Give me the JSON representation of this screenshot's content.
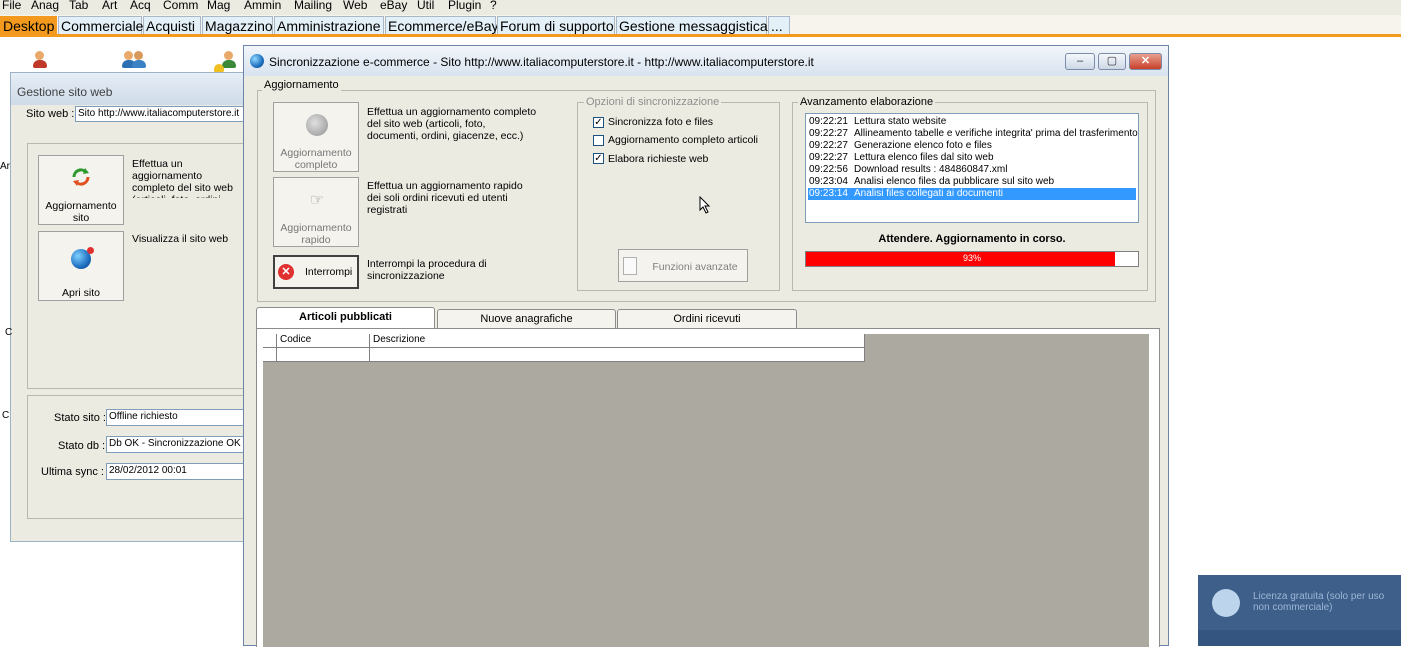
{
  "menubar": [
    "File",
    "Anag",
    "Tab",
    "Art",
    "Acq",
    "Comm",
    "Mag",
    "Ammin",
    "Mailing",
    "Web",
    "eBay",
    "Util",
    "Plugin",
    "?"
  ],
  "tabs": [
    "Desktop",
    "Commerciale",
    "Acquisti",
    "Magazzino",
    "Amministrazione",
    "Ecommerce/eBay",
    "Forum di supporto",
    "Gestione messaggistica",
    "..."
  ],
  "gestione": {
    "title": "Gestione sito web",
    "sito_label": "Sito web :",
    "sito_value": "Sito http://www.italiacomputerstore.it",
    "btn_aggiorna": "Aggiornamento sito",
    "btn_aggiorna_desc": "Effettua un aggiornamento completo del sito web (articoli, foto, ordini, giacenze, ecc.)",
    "btn_apri": "Apri sito",
    "btn_apri_desc": "Visualizza il sito web",
    "stato_sito_label": "Stato sito :",
    "stato_sito_value": "Offline richiesto",
    "stato_db_label": "Stato db :",
    "stato_db_value": "Db OK - Sincronizzazione OK",
    "ultima_sync_label": "Ultima sync :",
    "ultima_sync_value": "28/02/2012 00:01",
    "edge_letters": [
      "Ar",
      "C",
      "C"
    ]
  },
  "dialog": {
    "title": "Sincronizzazione e-commerce - Sito http://www.italiacomputerstore.it - http://www.italiacomputerstore.it",
    "winbtn_min": "–",
    "winbtn_max": "▢",
    "winbtn_close": "✕",
    "group_aggiornamento": "Aggiornamento",
    "btn_completo": "Aggiornamento completo",
    "btn_completo_desc": "Effettua un aggiornamento completo del sito web (articoli, foto, documenti, ordini, giacenze, ecc.)",
    "btn_rapido": "Aggiornamento rapido",
    "btn_rapido_desc": "Effettua un aggiornamento rapido dei soli ordini ricevuti ed utenti registrati",
    "btn_interrompi": "Interrompi",
    "btn_interrompi_desc": "Interrompi la procedura di sincronizzazione",
    "group_opzioni": "Opzioni di sincronizzazione",
    "options": [
      {
        "label": "Sincronizza foto e files",
        "checked": true
      },
      {
        "label": "Aggiornamento completo articoli",
        "checked": false
      },
      {
        "label": "Elabora richieste web",
        "checked": true
      }
    ],
    "btn_funzioni": "Funzioni avanzate",
    "group_avanzamento": "Avanzamento elaborazione",
    "log": [
      {
        "time": "09:22:21",
        "text": "Lettura stato website"
      },
      {
        "time": "09:22:27",
        "text": "Allineamento tabelle e verifiche integrita' prima del trasferimento"
      },
      {
        "time": "09:22:27",
        "text": "Generazione elenco foto e files"
      },
      {
        "time": "09:22:27",
        "text": "Lettura elenco files dal sito web"
      },
      {
        "time": "09:22:56",
        "text": "Download results : 484860847.xml"
      },
      {
        "time": "09:23:04",
        "text": "Analisi elenco files da pubblicare sul sito web"
      },
      {
        "time": "09:23:14",
        "text": "Analisi files collegati ai documenti"
      }
    ],
    "status_text": "Attendere. Aggiornamento in corso.",
    "progress": 93,
    "progress_label": "93%",
    "tabs": [
      "Articoli pubblicati",
      "Nuove anagrafiche",
      "Ordini ricevuti"
    ],
    "grid_columns": [
      "Codice",
      "Descrizione"
    ]
  },
  "teamviewer": {
    "text": "Licenza gratuita (solo per uso non commerciale)"
  },
  "colors": {
    "accent_orange": "#f39a1e",
    "progress_red": "#ff0000",
    "selection_blue": "#3399ff"
  }
}
